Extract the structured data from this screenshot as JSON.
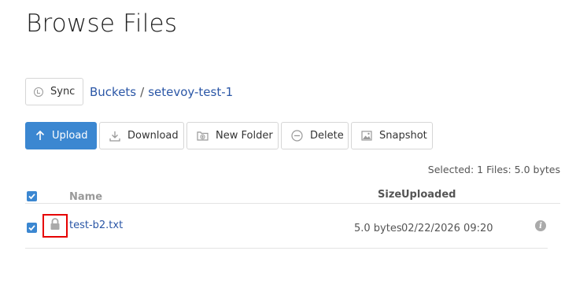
{
  "page": {
    "title": "Browse Files"
  },
  "sync": {
    "label": "Sync",
    "icon": "sync-icon"
  },
  "breadcrumb": {
    "root": "Buckets",
    "separator": "/",
    "current": "setevoy-test-1"
  },
  "toolbar": {
    "upload": "Upload",
    "download": "Download",
    "new_folder": "New Folder",
    "delete": "Delete",
    "snapshot": "Snapshot",
    "accent": "#3b87d1"
  },
  "selection": {
    "summary": "Selected: 1 Files: 5.0 bytes"
  },
  "table": {
    "headers": {
      "name": "Name",
      "size": "Size",
      "uploaded": "Uploaded"
    },
    "rows": [
      {
        "checked": true,
        "name": "test-b2.txt",
        "size": "5.0 bytes",
        "uploaded": "02/22/2026 09:20",
        "locked": true
      }
    ]
  },
  "highlight_color": "#e60000"
}
